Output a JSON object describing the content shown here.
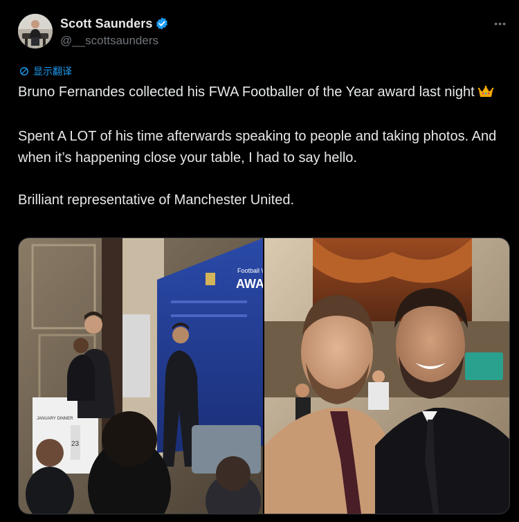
{
  "author": {
    "display_name": "Scott Saunders",
    "handle": "@__scottsaunders",
    "verified": true
  },
  "actions": {
    "more_label": "•••",
    "translate_label": "显示翻译"
  },
  "tweet": {
    "line1": "Bruno Fernandes collected his FWA Footballer of the Year award last night",
    "line1_emoji": "crown-emoji",
    "para2": "Spent A LOT of his time afterwards speaking to people and taking photos. And when it’s happening close your table, I had to say hello.",
    "para3": "Brilliant representative of Manchester United."
  },
  "media": {
    "photo1": {
      "backdrop_text_small": "Football Writ",
      "backdrop_text_big": "AWARD",
      "podium_text": "JANUARY DINNER",
      "table_number": "23"
    }
  },
  "colors": {
    "background": "#000000",
    "text": "#e7e9ea",
    "muted": "#71767b",
    "accent": "#1d9bf0"
  }
}
